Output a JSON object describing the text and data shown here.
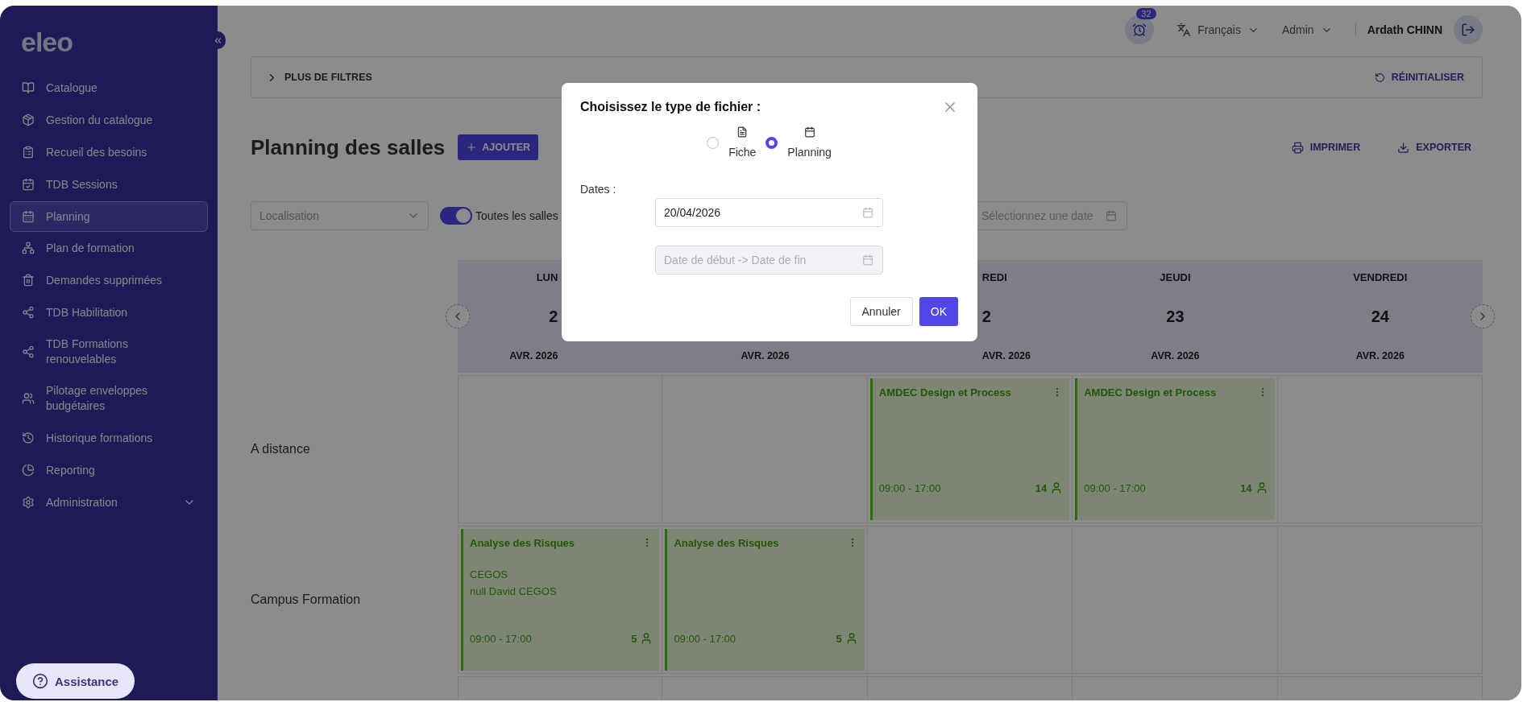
{
  "sidebar": {
    "logo": "eleo",
    "items": [
      {
        "label": "Catalogue",
        "selected": false,
        "kind": "link"
      },
      {
        "label": "Gestion du catalogue",
        "selected": false,
        "kind": "link"
      },
      {
        "label": "Recueil des besoins",
        "selected": false,
        "kind": "link"
      },
      {
        "label": "TDB Sessions",
        "selected": false,
        "kind": "link"
      },
      {
        "label": "Planning",
        "selected": true,
        "kind": "link"
      },
      {
        "label": "Plan de formation",
        "selected": false,
        "kind": "link"
      },
      {
        "label": "Demandes supprimées",
        "selected": false,
        "kind": "link"
      },
      {
        "label": "TDB Habilitation",
        "selected": false,
        "kind": "link"
      },
      {
        "label": "TDB Formations renouvelables",
        "selected": false,
        "kind": "link"
      },
      {
        "label": "Pilotage enveloppes budgétaires",
        "selected": false,
        "kind": "link"
      },
      {
        "label": "Historique formations",
        "selected": false,
        "kind": "link"
      },
      {
        "label": "Reporting",
        "selected": false,
        "kind": "link"
      },
      {
        "label": "Administration",
        "selected": false,
        "kind": "group",
        "expanded": false
      }
    ],
    "assistance": "Assistance"
  },
  "header": {
    "notifications": "32",
    "language": "Français",
    "role": "Admin",
    "user": "Ardath CHINN"
  },
  "filters": {
    "more": "PLUS DE FILTRES",
    "reset": "RÉINITIALISER"
  },
  "page": {
    "title": "Planning des salles",
    "add": "AJOUTER",
    "print": "IMPRIMER",
    "export": "EXPORTER"
  },
  "controls": {
    "location_placeholder": "Localisation",
    "toggle": {
      "label": "Toutes les salles",
      "on": true
    },
    "date_placeholder": "Sélectionnez une date"
  },
  "calendar": {
    "days": [
      {
        "day": "LUN",
        "date": "2",
        "month": "AVR. 2026"
      },
      {
        "month": "AVR. 2026"
      },
      {
        "day": "REDI",
        "date": "2",
        "month": "AVR. 2026"
      },
      {
        "day": "JEUDI",
        "date": "23",
        "month": "AVR. 2026"
      },
      {
        "day": "VENDREDI",
        "date": "24",
        "month": "AVR. 2026"
      }
    ],
    "rows": [
      {
        "label": "A distance",
        "cells": [
          {},
          {},
          {
            "event": {
              "title": "AMDEC Design et Process",
              "time": "09:00 - 17:00",
              "count": "14"
            }
          },
          {
            "event": {
              "title": "AMDEC Design et Process",
              "time": "09:00 - 17:00",
              "count": "14"
            }
          },
          {}
        ]
      },
      {
        "label": "Campus Formation",
        "cells": [
          {
            "event": {
              "title": "Analyse des Risques",
              "lines": [
                "CEGOS",
                "null David CEGOS"
              ],
              "time": "09:00 - 17:00",
              "count": "5"
            }
          },
          {
            "event": {
              "title": "Analyse des Risques",
              "time": "09:00 - 17:00",
              "count": "5"
            }
          },
          {},
          {},
          {}
        ]
      },
      {
        "cells": [
          {},
          {},
          {},
          {},
          {}
        ]
      }
    ]
  },
  "modal": {
    "title": "Choisissez le type de fichier :",
    "options": [
      {
        "label": "Fiche",
        "selected": false
      },
      {
        "label": "Planning",
        "selected": true
      }
    ],
    "dates_label": "Dates :",
    "date_value": "20/04/2026",
    "range_placeholder": "Date de début -> Date de fin",
    "range_disabled": true,
    "cancel": "Annuler",
    "ok": "OK"
  }
}
